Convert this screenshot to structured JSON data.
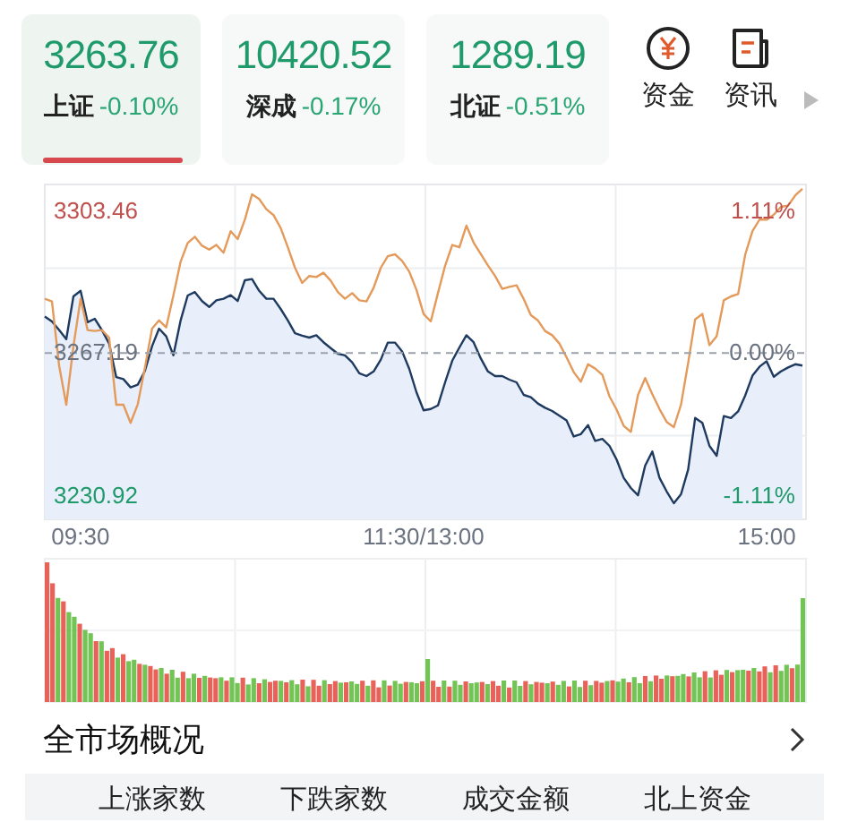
{
  "index_tabs": [
    {
      "value": "3263.76",
      "name": "上证",
      "change": "-0.10%",
      "selected": true
    },
    {
      "value": "10420.52",
      "name": "深成",
      "change": "-0.17%",
      "selected": false
    },
    {
      "value": "1289.19",
      "name": "北证",
      "change": "-0.51%",
      "selected": false
    }
  ],
  "shortcuts": [
    {
      "kind": "money",
      "label": "资金"
    },
    {
      "kind": "news",
      "label": "资讯"
    }
  ],
  "intraday": {
    "percent_labels": [
      "1.11%",
      "0.00%",
      "-1.11%"
    ],
    "chart_data": {
      "type": "line",
      "categories": [
        null,
        null,
        null,
        null,
        null,
        "09:30",
        null,
        null,
        null,
        null,
        null,
        null,
        null,
        null,
        null,
        null,
        null,
        null,
        null,
        null,
        null,
        null,
        null,
        null,
        null,
        null,
        null,
        null,
        null,
        null,
        null,
        null,
        null,
        null,
        null,
        null,
        null,
        null,
        null,
        null,
        null,
        null,
        null,
        null,
        null,
        null,
        null,
        null,
        null,
        null,
        null,
        null,
        null,
        "11:30/13:00",
        null,
        null,
        null,
        null,
        null,
        null,
        null,
        null,
        null,
        null,
        null,
        null,
        null,
        null,
        null,
        null,
        null,
        null,
        null,
        null,
        null,
        null,
        null,
        null,
        null,
        null,
        null,
        null,
        null,
        null,
        null,
        null,
        null,
        null,
        null,
        null,
        null,
        null,
        null,
        null,
        null,
        null,
        null,
        null,
        null,
        null,
        null,
        "15:00",
        null,
        null,
        null,
        null,
        null
      ],
      "series": [
        {
          "color": "#1e3a5f",
          "type": "area",
          "values": [
            3276.5,
            3275.2,
            3273.0,
            3270.7,
            3281.6,
            3283,
            3275,
            3275.9,
            3273,
            3269.6,
            3261,
            3260.5,
            3258.4,
            3259.1,
            3262.6,
            3268.9,
            3273.4,
            3271.4,
            3266.6,
            3275.4,
            3281.8,
            3282.7,
            3280.4,
            3278.9,
            3280.6,
            3281.0,
            3281.9,
            3280.4,
            3285.7,
            3286.0,
            3283.0,
            3281.0,
            3281.0,
            3278.4,
            3275.5,
            3272.2,
            3271.6,
            3271.1,
            3271.7,
            3269.9,
            3268.4,
            3267.0,
            3266.6,
            3264.8,
            3262.0,
            3261.3,
            3262.5,
            3265.5,
            3269.8,
            3269.8,
            3267.6,
            3263.1,
            3257.2,
            3252.6,
            3252.9,
            3253.8,
            3259.7,
            3265.2,
            3268.6,
            3271.7,
            3269.9,
            3265.8,
            3262.5,
            3261.3,
            3261.3,
            3260.4,
            3259.7,
            3256.5,
            3255.9,
            3254.3,
            3253.2,
            3252.4,
            3251.2,
            3250.0,
            3245.9,
            3246.5,
            3248.8,
            3244.8,
            3245.3,
            3243.5,
            3240.1,
            3235.4,
            3232.8,
            3230.9,
            3238.5,
            3242.1,
            3235.4,
            3231.9,
            3228.9,
            3231.2,
            3237.5,
            3250.6,
            3249.4,
            3243.5,
            3241.0,
            3251.1,
            3250.6,
            3252.3,
            3256.4,
            3261.4,
            3263.7,
            3265.1,
            3261.1,
            3262.5,
            3263.5,
            3264.3,
            3264.0
          ]
        },
        {
          "color": "#e39a5a",
          "values": [
            3281.0,
            3280.3,
            3264.0,
            3254.0,
            3268.9,
            3281,
            3273,
            3272.8,
            3273,
            3271.1,
            3254,
            3254.0,
            3249.4,
            3254.1,
            3263.4,
            3273.4,
            3275.5,
            3273.7,
            3281.8,
            3290.4,
            3295.2,
            3296.8,
            3294.5,
            3293.5,
            3294.7,
            3292.7,
            3298.2,
            3296.2,
            3301.1,
            3307.6,
            3306.4,
            3303.8,
            3302.3,
            3299.0,
            3294.1,
            3288.9,
            3285.0,
            3286.8,
            3286.5,
            3287.6,
            3285.6,
            3282.7,
            3281.0,
            3282.4,
            3280.6,
            3280.3,
            3283.8,
            3288.9,
            3291.8,
            3292.3,
            3290.6,
            3287.9,
            3283.3,
            3277.1,
            3275.2,
            3282.4,
            3289.4,
            3294.7,
            3294.1,
            3299.6,
            3295.3,
            3292.4,
            3289.5,
            3286.8,
            3283.5,
            3284.0,
            3284.4,
            3280.9,
            3276.8,
            3275.5,
            3272.8,
            3271.7,
            3269.6,
            3266.1,
            3262.3,
            3259.9,
            3264.3,
            3263.2,
            3261.6,
            3256.1,
            3252.8,
            3248.6,
            3247.1,
            3256.5,
            3260.8,
            3256.7,
            3252.9,
            3249.6,
            3248.3,
            3254.0,
            3264.6,
            3275.7,
            3277.1,
            3269.2,
            3271.4,
            3280.6,
            3281.6,
            3282.2,
            3292.3,
            3298.2,
            3301.2,
            3301.1,
            3302.4,
            3304.4,
            3304.7,
            3307.3,
            3309.0
          ]
        }
      ],
      "ref_lines": [
        {
          "axis": "y",
          "value": 3267.19,
          "label": "3267.19"
        }
      ],
      "ylim": [
        3224.8,
        3310.1
      ],
      "yticks": [
        {
          "value": 3303.46,
          "label": "3303.46"
        },
        {
          "value": 3230.92,
          "label": "3230.92"
        }
      ]
    }
  },
  "section": {
    "title": "全市场概况"
  },
  "stat_tabs": [
    "上涨家数",
    "下跌家数",
    "成交金额",
    "北上资金"
  ]
}
